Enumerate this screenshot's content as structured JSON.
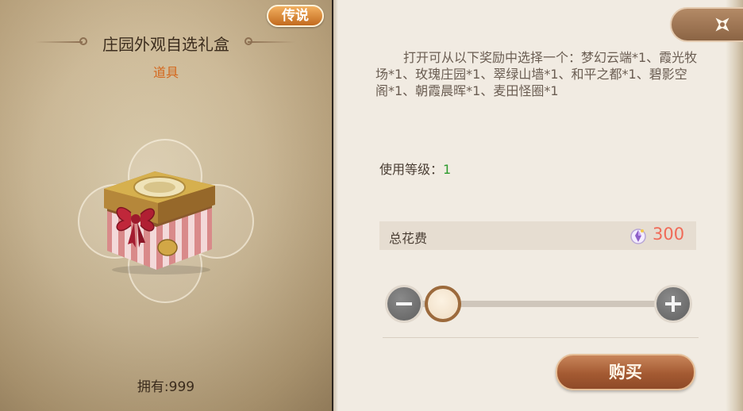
{
  "item": {
    "rarity": "传说",
    "name": "庄园外观自选礼盒",
    "category": "道具",
    "owned": "拥有:999",
    "icon": "gift-box-icon"
  },
  "detail": {
    "description": "打开可从以下奖励中选择一个：梦幻云端*1、霞光牧场*1、玫瑰庄园*1、翠绿山墙*1、和平之都*1、碧影空阁*1、朝霞晨晖*1、麦田怪圈*1",
    "level_label": "使用等级：",
    "level_value": "1"
  },
  "cost": {
    "label": "总花费",
    "value": "300",
    "currency_icon": "crystal-currency-icon"
  },
  "quantity": {
    "slider_level": 0.05
  },
  "buttons": {
    "buy": "购买",
    "close_icon": "close-icon"
  },
  "colors": {
    "rarity": "#d9863a",
    "price": "#f06a57",
    "level": "#2d9a2d",
    "category": "#d4671c"
  }
}
